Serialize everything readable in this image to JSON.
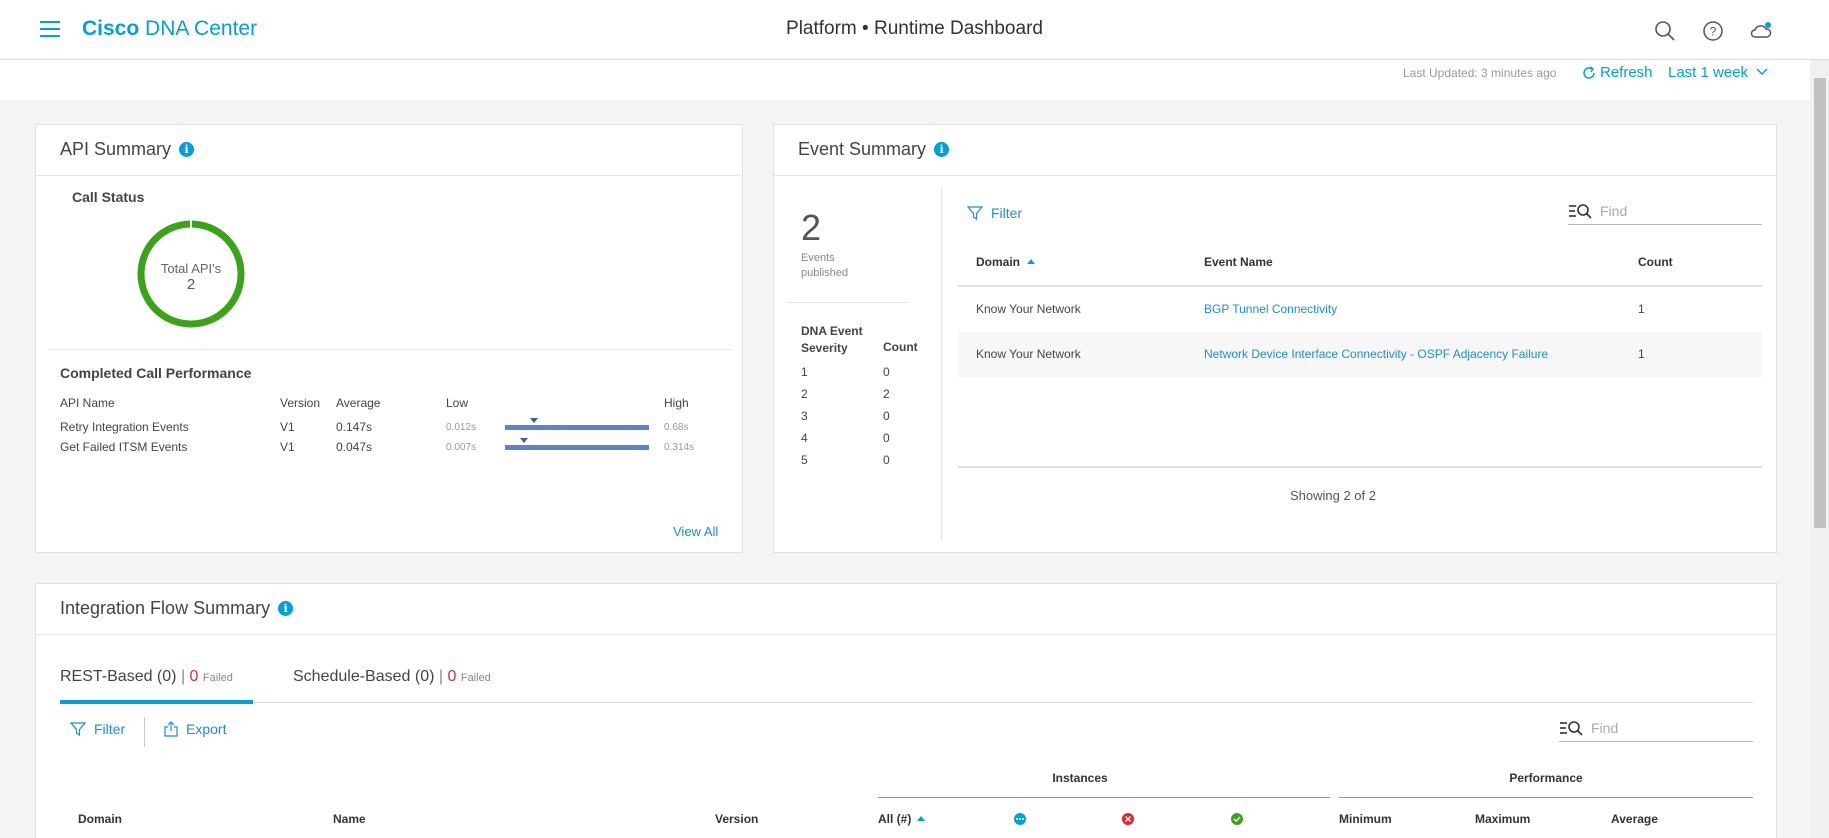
{
  "header": {
    "brand_bold": "Cisco",
    "brand_rest": "DNA Center",
    "title_prefix": "Platform",
    "title_sep": "•",
    "title_main": "Runtime Dashboard"
  },
  "toolbar": {
    "last_updated": "Last Updated: 3 minutes ago",
    "refresh_label": "Refresh",
    "range_label": "Last 1 week"
  },
  "api_summary": {
    "title": "API Summary",
    "call_status_label": "Call Status",
    "donut_label": "Total API's",
    "donut_value": "2",
    "perf_title": "Completed Call Performance",
    "columns": {
      "name": "API Name",
      "version": "Version",
      "average": "Average",
      "low": "Low",
      "high": "High"
    },
    "rows": [
      {
        "name": "Retry Integration Events",
        "version": "V1",
        "average": "0.147s",
        "low": "0.012s",
        "high": "0.68s",
        "position": 0.2
      },
      {
        "name": "Get Failed ITSM Events",
        "version": "V1",
        "average": "0.047s",
        "low": "0.007s",
        "high": "0.314s",
        "position": 0.13
      }
    ],
    "view_all": "View All"
  },
  "event_summary": {
    "title": "Event Summary",
    "published_count": "2",
    "published_label_1": "Events",
    "published_label_2": "published",
    "severity_header_1": "DNA Event",
    "severity_header_2": "Severity",
    "count_header": "Count",
    "severity": [
      {
        "level": "1",
        "count": "0"
      },
      {
        "level": "2",
        "count": "2"
      },
      {
        "level": "3",
        "count": "0"
      },
      {
        "level": "4",
        "count": "0"
      },
      {
        "level": "5",
        "count": "0"
      }
    ],
    "filter_label": "Filter",
    "find_placeholder": "Find",
    "table_headers": {
      "domain": "Domain",
      "event_name": "Event Name",
      "count": "Count"
    },
    "rows": [
      {
        "domain": "Know Your Network",
        "event_name": "BGP Tunnel Connectivity",
        "count": "1"
      },
      {
        "domain": "Know Your Network",
        "event_name": "Network Device Interface Connectivity - OSPF Adjacency Failure",
        "count": "1"
      }
    ],
    "showing": "Showing 2 of 2"
  },
  "integration_flow": {
    "title": "Integration Flow Summary",
    "tabs": [
      {
        "label": "REST-Based (0)",
        "pipe": "|",
        "failed_count": "0",
        "failed_label": "Failed"
      },
      {
        "label": "Schedule-Based (0)",
        "pipe": "|",
        "failed_count": "0",
        "failed_label": "Failed"
      }
    ],
    "filter_label": "Filter",
    "export_label": "Export",
    "find_placeholder": "Find",
    "group_instances": "Instances",
    "group_performance": "Performance",
    "columns": {
      "domain": "Domain",
      "name": "Name",
      "version": "Version",
      "all": "All (#)",
      "minimum": "Minimum",
      "maximum": "Maximum",
      "average": "Average"
    }
  },
  "colors": {
    "accent": "#049fd9",
    "donut": "#3aa31a",
    "bar": "#5a83c9",
    "error": "#e0262d",
    "success": "#3aa31a"
  }
}
